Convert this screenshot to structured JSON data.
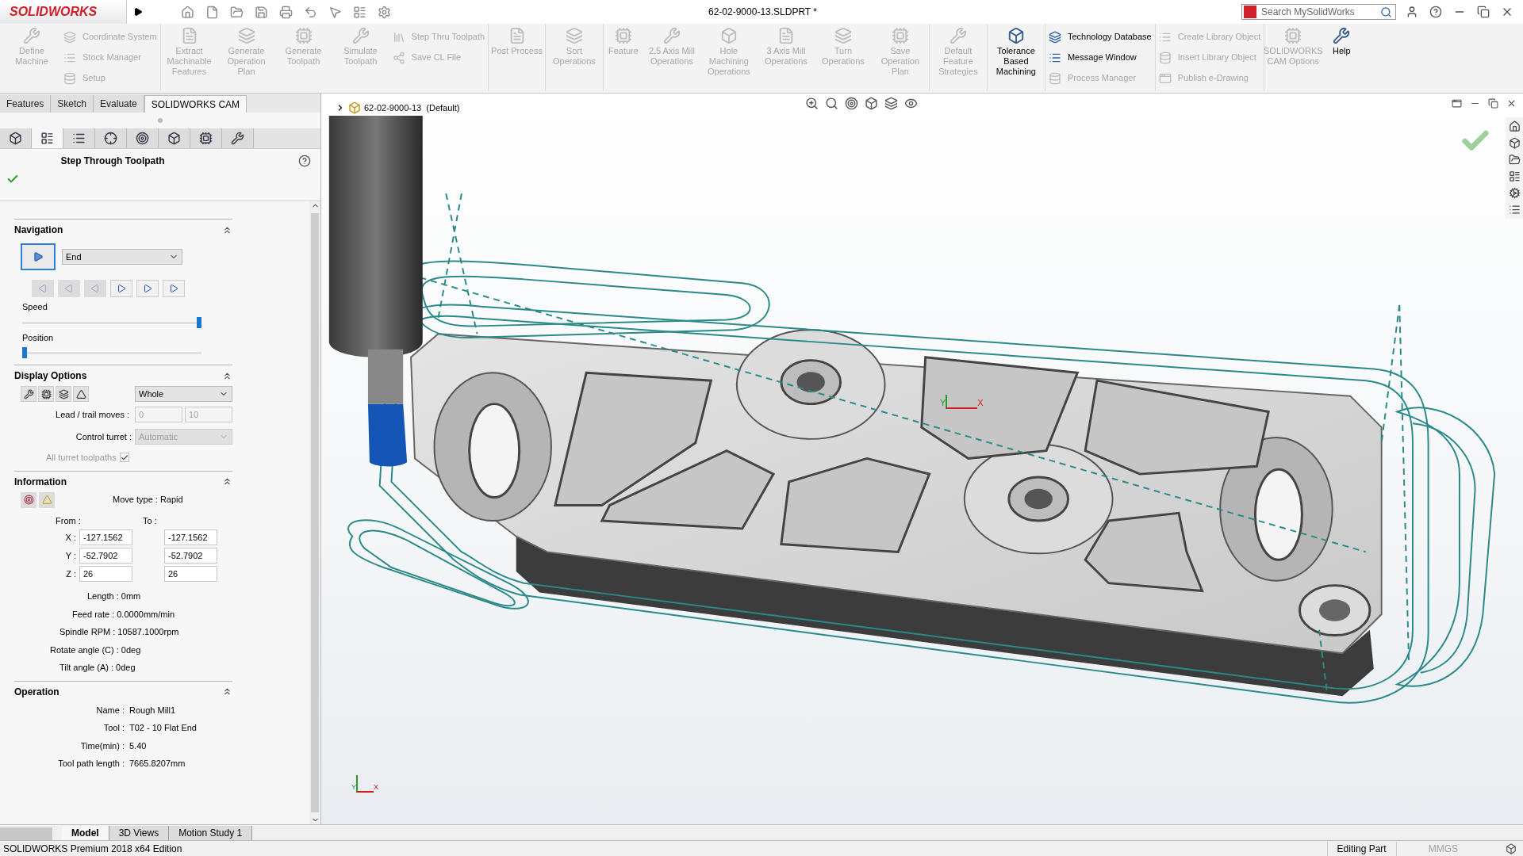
{
  "title_bar": {
    "logo": "SOLIDWORKS",
    "document_title": "62-02-9000-13.SLDPRT *",
    "search": {
      "placeholder": "Search MySolidWorks"
    }
  },
  "ribbon": [
    {
      "kind": "large",
      "label": "Define Machine",
      "disabled": true
    },
    {
      "kind": "stack",
      "items": [
        {
          "label": "Coordinate System",
          "disabled": true
        },
        {
          "label": "Stock Manager",
          "disabled": true
        },
        {
          "label": "Setup",
          "disabled": true
        }
      ]
    },
    {
      "kind": "large",
      "label": "Extract Machinable Features",
      "disabled": true
    },
    {
      "kind": "large",
      "label": "Generate Operation Plan",
      "disabled": true
    },
    {
      "kind": "large",
      "label": "Generate Toolpath",
      "disabled": true
    },
    {
      "kind": "large",
      "label": "Simulate Toolpath",
      "disabled": true
    },
    {
      "kind": "stack",
      "items": [
        {
          "label": "Step Thru Toolpath",
          "disabled": true
        },
        {
          "label": "Save CL File",
          "disabled": true
        }
      ]
    },
    {
      "kind": "large",
      "label": "Post Process",
      "disabled": true
    },
    {
      "kind": "large",
      "label": "Sort Operations",
      "disabled": true
    },
    {
      "kind": "large",
      "label": "Feature",
      "disabled": true
    },
    {
      "kind": "large",
      "label": "2.5 Axis Mill Operations",
      "disabled": true
    },
    {
      "kind": "large",
      "label": "Hole Machining Operations",
      "disabled": true
    },
    {
      "kind": "large",
      "label": "3 Axis Mill Operations",
      "disabled": true
    },
    {
      "kind": "large",
      "label": "Turn Operations",
      "disabled": true
    },
    {
      "kind": "large",
      "label": "Save Operation Plan",
      "disabled": true
    },
    {
      "kind": "large",
      "label": "Default Feature Strategies",
      "disabled": true
    },
    {
      "kind": "large",
      "label": "Tolerance Based Machining",
      "disabled": false
    },
    {
      "kind": "stack",
      "items": [
        {
          "label": "Technology Database",
          "disabled": false
        },
        {
          "label": "Message Window",
          "disabled": false
        },
        {
          "label": "Process Manager",
          "disabled": true
        }
      ]
    },
    {
      "kind": "stack",
      "items": [
        {
          "label": "Create Library Object",
          "disabled": true
        },
        {
          "label": "Insert Library Object",
          "disabled": true
        },
        {
          "label": "Publish e-Drawing",
          "disabled": true
        }
      ]
    },
    {
      "kind": "large",
      "label": "SOLIDWORKS CAM Options",
      "disabled": true
    },
    {
      "kind": "large",
      "label": "Help",
      "disabled": false
    }
  ],
  "command_tabs": [
    {
      "label": "Features",
      "selected": false
    },
    {
      "label": "Sketch",
      "selected": false
    },
    {
      "label": "Evaluate",
      "selected": false
    },
    {
      "label": "SOLIDWORKS CAM",
      "selected": true
    }
  ],
  "panel_tabs": [
    {
      "selected": false
    },
    {
      "selected": true
    },
    {
      "selected": false
    },
    {
      "selected": false
    },
    {
      "selected": false
    },
    {
      "selected": false
    },
    {
      "selected": false
    },
    {
      "selected": false
    }
  ],
  "property_manager": {
    "title": "Step Through Toolpath"
  },
  "navigation": {
    "heading": "Navigation",
    "mode": "End",
    "steps": [
      {
        "disabled": true
      },
      {
        "disabled": true
      },
      {
        "disabled": true
      },
      {
        "disabled": false
      },
      {
        "disabled": false
      },
      {
        "disabled": false
      }
    ],
    "sliders": [
      {
        "label": "Speed",
        "level": 1
      },
      {
        "label": "Position",
        "level": 0
      }
    ]
  },
  "display_options": {
    "heading": "Display Options",
    "range": "Whole",
    "lead_trail": {
      "label": "Lead / trail moves :",
      "values": [
        "0",
        "10"
      ]
    },
    "control_turret": {
      "label": "Control turret :",
      "value": "Automatic",
      "disabled": true
    },
    "all_turret": {
      "label": "All turret toolpaths",
      "checked": true,
      "disabled": true
    }
  },
  "information": {
    "heading": "Information",
    "move_type": "Move type : Rapid",
    "from_label": "From :",
    "to_label": "To :",
    "coords": [
      {
        "axis": "X :",
        "from": "-127.1562",
        "to": "-127.1562"
      },
      {
        "axis": "Y :",
        "from": "-52.7902",
        "to": "-52.7902"
      },
      {
        "axis": "Z :",
        "from": "26",
        "to": "26"
      }
    ],
    "details": [
      "Length : 0mm",
      "Feed rate : 0.0000mm/min",
      "Spindle RPM : 10587.1000rpm",
      "Rotate angle (C) : 0deg",
      "Tilt angle (A) : 0deg"
    ]
  },
  "operation": {
    "heading": "Operation",
    "rows": [
      {
        "label": "Name :",
        "value": "Rough Mill1"
      },
      {
        "label": "Tool :",
        "value": "T02 - 10 Flat End"
      },
      {
        "label": "Time(min) :",
        "value": "5.40"
      },
      {
        "label": "Tool path length :",
        "value": "7665.8207mm"
      }
    ]
  },
  "viewport": {
    "tree_item": "62-02-9000-13  (Default)",
    "part_triad": [
      "Y",
      "X"
    ],
    "corner_triad": [
      "Y",
      "X"
    ]
  },
  "model_tabs": [
    {
      "label": "Model",
      "selected": true
    },
    {
      "label": "3D Views",
      "selected": false
    },
    {
      "label": "Motion Study 1",
      "selected": false
    }
  ],
  "status_bar": {
    "edition": "SOLIDWORKS Premium 2018 x64 Edition",
    "mode": "Editing Part",
    "units": "MMGS"
  }
}
